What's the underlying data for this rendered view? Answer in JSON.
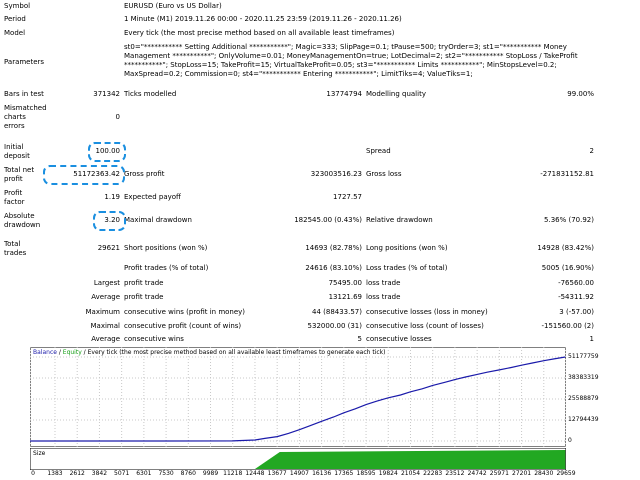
{
  "report": {
    "symbol_label": "Symbol",
    "symbol_value": "EURUSD (Euro vs US Dollar)",
    "period_label": "Period",
    "period_value": "1 Minute (M1) 2019.11.26 00:00 - 2020.11.25 23:59 (2019.11.26 - 2020.11.26)",
    "model_label": "Model",
    "model_value": "Every tick (the most precise method based on all available least timeframes)",
    "parameters_label": "Parameters",
    "parameters_lines": [
      "st0=\"*********** Setting Additional ***********\"; Magic=333; SlipPage=0.1; tPause=500; tryOrder=3; st1=\"*********** Money",
      "Management ***********\"; OnlyVolume=0.01; MoneyManagementOn=true; LotDecimal=2; st2=\"*********** StopLoss / TakeProfit",
      "***********\"; StopLoss=15; TakeProfit=15; VirtualTakeProfit=0.05; st3=\"*********** Limits ***********\"; MinStopsLevel=0.2;",
      "MaxSpread=0.2; Commission=0; st4=\"*********** Entering ***********\"; LimitTiks=4; ValueTiks=1;"
    ],
    "bars_label": "Bars in test",
    "bars_value": "371342",
    "ticks_label": "Ticks modelled",
    "ticks_value": "13774794",
    "quality_label": "Modelling quality",
    "quality_value": "99.00%",
    "mismatched_label_1": "Mismatched",
    "mismatched_label_2": "charts",
    "mismatched_label_3": "errors",
    "mismatched_value": "0",
    "initial_label_1": "Initial",
    "initial_label_2": "deposit",
    "initial_value": "100.00",
    "spread_label": "Spread",
    "spread_value": "2",
    "net_label_1": "Total net",
    "net_label_2": "profit",
    "net_value": "51172363.42",
    "gross_profit_label": "Gross profit",
    "gross_profit_value": "323003516.23",
    "gross_loss_label": "Gross loss",
    "gross_loss_value": "-271831152.81",
    "pf_label_1": "Profit",
    "pf_label_2": "factor",
    "pf_value": "1.19",
    "expected_label": "Expected payoff",
    "expected_value": "1727.57",
    "abs_dd_label_1": "Absolute",
    "abs_dd_label_2": "drawdown",
    "abs_dd_value": "3.20",
    "max_dd_label": "Maximal drawdown",
    "max_dd_value": "182545.00 (0.43%)",
    "rel_dd_label": "Relative drawdown",
    "rel_dd_value": "5.36% (70.92)",
    "trades_label_1": "Total",
    "trades_label_2": "trades",
    "trades_value": "29621",
    "short_label": "Short positions (won %)",
    "short_value": "14693 (82.78%)",
    "long_label": "Long positions (won %)",
    "long_value": "14928 (83.42%)",
    "profit_trades_label": "Profit trades (% of total)",
    "profit_trades_value": "24616 (83.10%)",
    "loss_trades_label": "Loss trades (% of total)",
    "loss_trades_value": "5005 (16.90%)",
    "largest_label": "Largest",
    "largest_profit_label": "profit trade",
    "largest_profit_value": "75495.00",
    "largest_loss_label": "loss trade",
    "largest_loss_value": "-76560.00",
    "average_label": "Average",
    "average_profit_label": "profit trade",
    "average_profit_value": "13121.69",
    "average_loss_label": "loss trade",
    "average_loss_value": "-54311.92",
    "maximum_label": "Maximum",
    "max_cons_wins_label": "consecutive wins (profit in money)",
    "max_cons_wins_value": "44 (88433.57)",
    "max_cons_losses_label": "consecutive losses (loss in money)",
    "max_cons_losses_value": "3 (-57.00)",
    "maximal_label": "Maximal",
    "maximal_profit_label": "consecutive profit (count of wins)",
    "maximal_profit_value": "532000.00 (31)",
    "maximal_loss_label": "consecutive loss (count of losses)",
    "maximal_loss_value": "-151560.00 (2)",
    "avg_cons_label": "Average",
    "avg_cons_wins_label": "consecutive wins",
    "avg_cons_wins_value": "5",
    "avg_cons_losses_label": "consecutive losses",
    "avg_cons_losses_value": "1"
  },
  "chart_legend": {
    "balance": "Balance",
    "sep1": " / ",
    "equity": "Equity",
    "rest": " / Every tick (the most precise method based on all available least timeframes to generate each tick)"
  },
  "size_label": "Size",
  "colors": {
    "balance": "#1a1aaa",
    "equity": "#1aa01a",
    "size": "#22a822",
    "highlight": "#1a8fe0"
  },
  "chart_data": {
    "type": "line",
    "x_ticks": [
      "0",
      "1383",
      "2612",
      "3842",
      "5071",
      "6301",
      "7530",
      "8760",
      "9989",
      "11218",
      "12448",
      "13677",
      "14907",
      "16136",
      "17365",
      "18595",
      "19824",
      "21054",
      "22283",
      "23512",
      "24742",
      "25971",
      "27201",
      "28430",
      "29659"
    ],
    "y_ticks": [
      "51177759",
      "38383319",
      "25588879",
      "12794439",
      "0"
    ],
    "ylim": [
      0,
      51177759
    ],
    "xlim": [
      0,
      29659
    ],
    "series": [
      {
        "name": "Balance",
        "x": [
          0,
          7530,
          11218,
          12448,
          13000,
          13677,
          14300,
          14907,
          15500,
          16136,
          16800,
          17365,
          18000,
          18595,
          19200,
          19824,
          20500,
          21054,
          21700,
          22283,
          22900,
          23512,
          24100,
          24742,
          25300,
          25971,
          26600,
          27201,
          27800,
          28430,
          29000,
          29621
        ],
        "values": [
          100,
          1000,
          80000,
          600000,
          1600000,
          2700000,
          4600000,
          6900000,
          9300000,
          12000000,
          14600000,
          17200000,
          19600000,
          22200000,
          24300000,
          26300000,
          28000000,
          30000000,
          31800000,
          33900000,
          35600000,
          37400000,
          39000000,
          40600000,
          41900000,
          43300000,
          44700000,
          46200000,
          47500000,
          48900000,
          50000000,
          51172363
        ]
      }
    ],
    "size_bars": {
      "name": "Size",
      "start_x": 12448,
      "end_x": 29621
    }
  }
}
